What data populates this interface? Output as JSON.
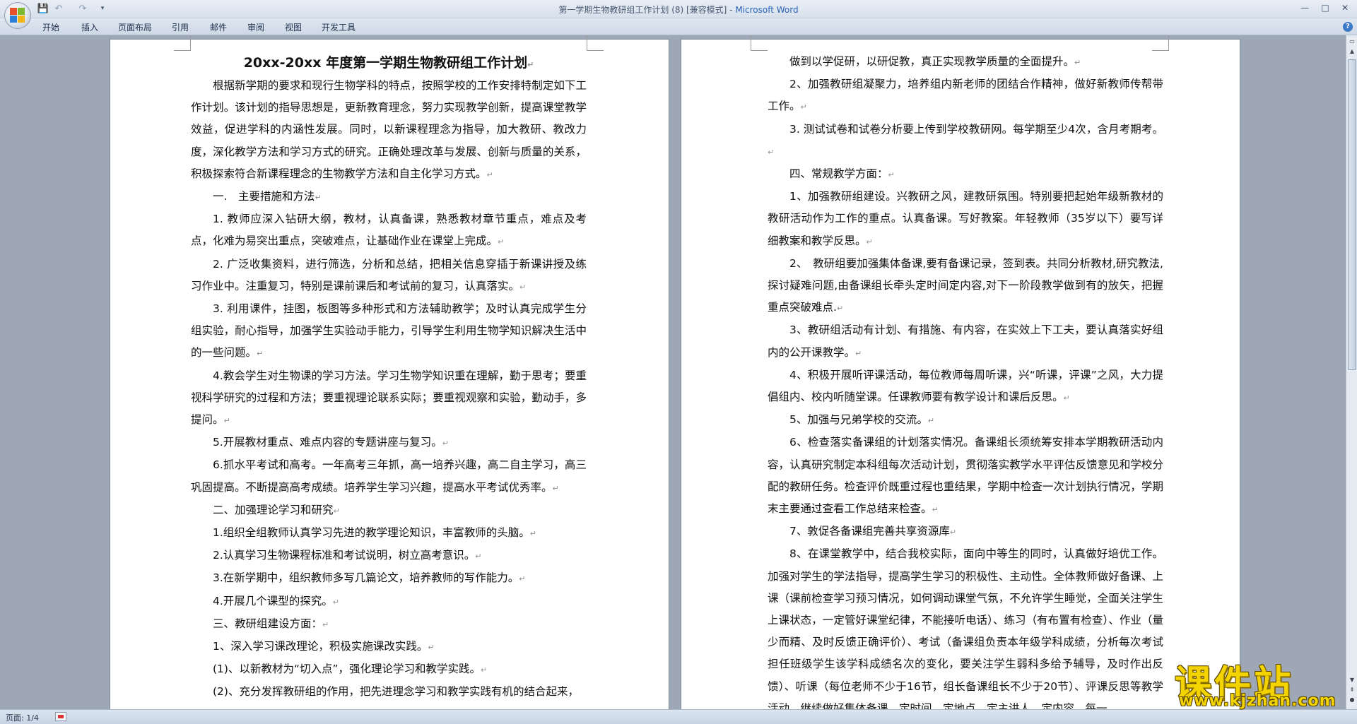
{
  "window": {
    "title": "第一学期生物教研组工作计划 (8) [兼容模式] - ",
    "app_name": "Microsoft Word",
    "controls": {
      "minimize": "—",
      "maximize": "□",
      "close": "✕"
    }
  },
  "quick_access": {
    "save_icon": "💾",
    "undo_icon": "↶",
    "redo_icon": "↷",
    "more_icon": "▾"
  },
  "menu_tabs": [
    "开始",
    "插入",
    "页面布局",
    "引用",
    "邮件",
    "审阅",
    "视图",
    "开发工具"
  ],
  "help_label": "?",
  "icons": {
    "office_button": "office-logo-icon",
    "help": "help-icon",
    "paragraph_mark": "↵"
  },
  "document": {
    "title": "20xx-20xx 年度第一学期生物教研组工作计划",
    "left_page": [
      "根据新学期的要求和现行生物学科的特点，按照学校的工作安排特制定如下工作计划。该计划的指导思想是，更新教育理念，努力实现教学创新，提高课堂教学效益，促进学科的内涵性发展。同时，以新课程理念为指导，加大教研、教改力度，深化教学方法和学习方式的研究。正确处理改革与发展、创新与质量的关系，积极探索符合新课程理念的生物教学方法和自主化学习方式。",
      "一.　主要措施和方法",
      "1. 教师应深入钻研大纲，教材，认真备课，熟悉教材章节重点，难点及考点，化难为易突出重点，突破难点，让基础作业在课堂上完成。",
      "2. 广泛收集资料，进行筛选，分析和总结，把相关信息穿插于新课讲授及练习作业中。注重复习，特别是课前课后和考试前的复习，认真落实。",
      "3. 利用课件，挂图，板图等多种形式和方法辅助教学；及时认真完成学生分组实验，耐心指导，加强学生实验动手能力，引导学生利用生物学知识解决生活中的一些问题。",
      "4.教会学生对生物课的学习方法。学习生物学知识重在理解，勤于思考；要重视科学研究的过程和方法；要重视理论联系实际；要重视观察和实验，勤动手，多提问。",
      "5.开展教材重点、难点内容的专题讲座与复习。",
      "6.抓水平考试和高考。一年高考三年抓，高一培养兴趣，高二自主学习，高三巩固提高。不断提高高考成绩。培养学生学习兴趣，提高水平考试优秀率。",
      "二、加强理论学习和研究",
      "1.组织全组教师认真学习先进的教学理论知识，丰富教师的头脑。",
      "2.认真学习生物课程标准和考试说明，树立高考意识。",
      "3.在新学期中，组织教师多写几篇论文，培养教师的写作能力。",
      "4.开展几个课型的探究。",
      "三、教研组建设方面：",
      "1、深入学习课改理论，积极实施课改实践。",
      "(1)、以新教材为“切入点”，强化理论学习和教学实践。",
      "(2)、充分发挥教研组的作用，把先进理念学习和教学实践有机的结合起来，"
    ],
    "right_page": [
      "做到以学促研，以研促教，真正实现教学质量的全面提升。",
      "2、加强教研组凝聚力，培养组内新老师的团结合作精神，做好新教师传帮带工作。",
      "3. 测试试卷和试卷分析要上传到学校教研网。每学期至少4次，含月考期考。",
      "四、常规教学方面：",
      "1、加强教研组建设。兴教研之风，建教研氛围。特别要把起始年级新教材的教研活动作为工作的重点。认真备课。写好教案。年轻教师（35岁以下）要写详细教案和教学反思。",
      "2、　教研组要加强集体备课,要有备课记录，签到表。共同分析教材,研究教法,探讨疑难问题,由备课组长牵头定时间定内容,对下一阶段教学做到有的放矢，把握重点突破难点.",
      "3、教研组活动有计划、有措施、有内容，在实效上下工夫，要认真落实好组内的公开课教学。",
      "4、积极开展听评课活动，每位教师每周听课，兴“听课，评课”之风，大力提倡组内、校内听随堂课。任课教师要有教学设计和课后反思。",
      "5、加强与兄弟学校的交流。",
      "6、检查落实备课组的计划落实情况。备课组长须统筹安排本学期教研活动内容，认真研究制定本科组每次活动计划，贯彻落实教学水平评估反馈意见和学校分配的教研任务。检查评价既重过程也重结果，学期中检查一次计划执行情况，学期末主要通过查看工作总结来检查。",
      "7、敦促各备课组完善共享资源库",
      "8、在课堂教学中，结合我校实际，面向中等生的同时，认真做好培优工作。加强对学生的学法指导，提高学生学习的积极性、主动性。全体教师做好备课、上课（课前检查学习预习情况，如何调动课堂气氛，不允许学生睡觉，全面关注学生上课状态，一定管好课堂纪律，不能接听电话）、练习（有布置有检查）、作业（量少而精、及时反馈正确评价）、考试（备课组负责本年级学科成绩，分析每次考试担任班级学生该学科成绩名次的变化，要关注学生弱科多给予辅导，及时作出反馈）、听课（每位老师不少于16节，组长备课组长不少于20节）、评课反思等教学活动。继续做好集体备课，定时间、定地点、定主讲人、定内容。每一"
    ]
  },
  "statusbar": {
    "page_info": "页面: 1/4"
  },
  "watermark": {
    "text": "课件站",
    "url": "www.kjzhan.com"
  }
}
